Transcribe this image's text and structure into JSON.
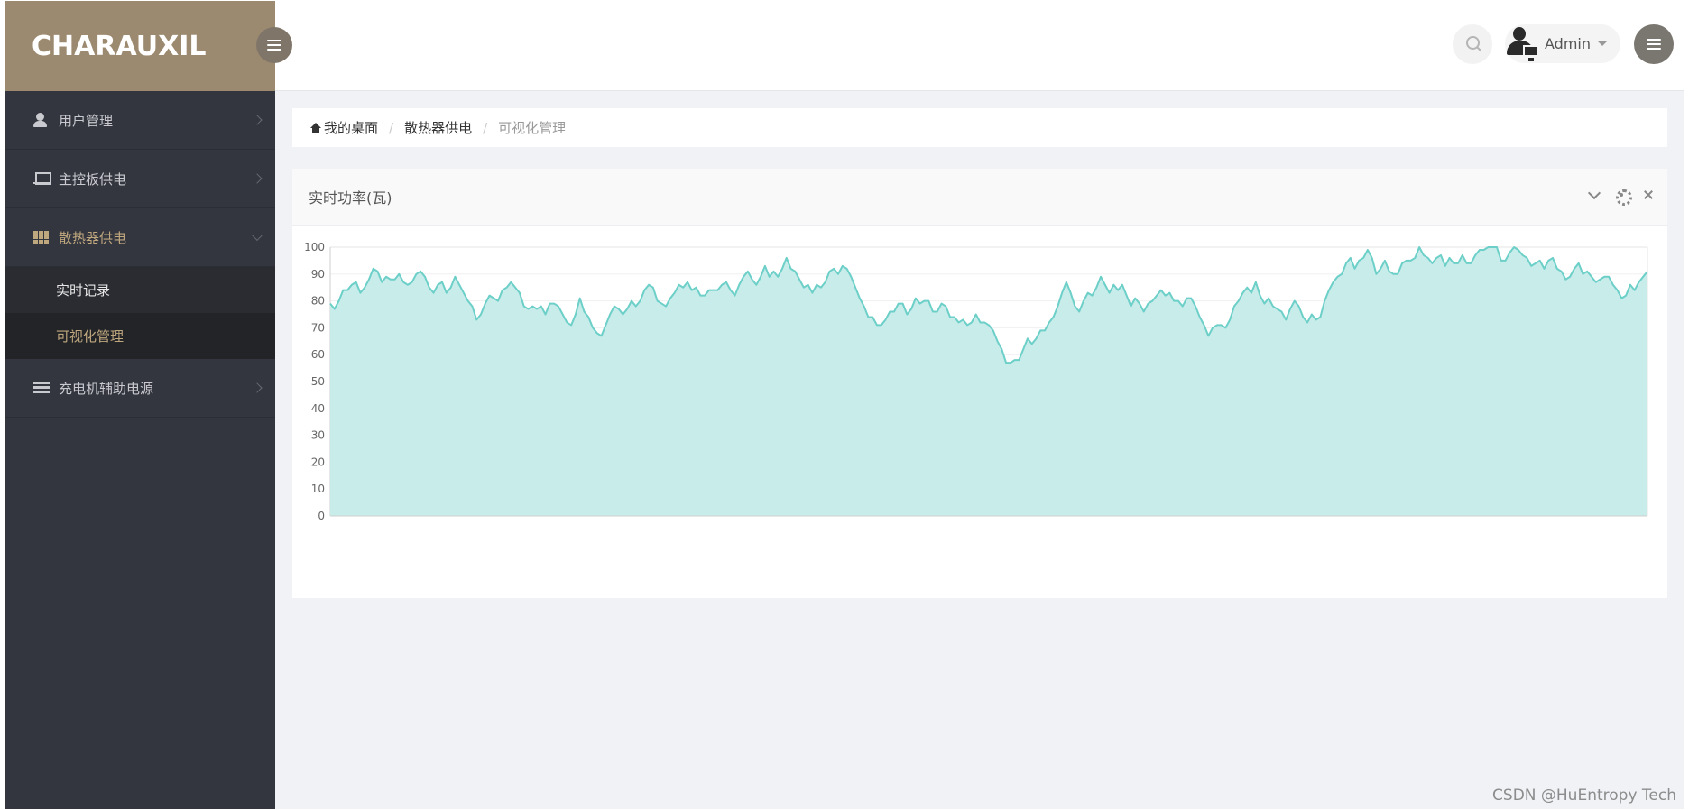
{
  "brand": {
    "name": "CHARAUXIL",
    "color": "#9c8a70"
  },
  "sidebar": {
    "items": [
      {
        "label": "用户管理",
        "icon": "user-icon"
      },
      {
        "label": "主控板供电",
        "icon": "laptop-icon"
      },
      {
        "label": "散热器供电",
        "icon": "grid-icon",
        "open": true,
        "children": [
          {
            "label": "实时记录"
          },
          {
            "label": "可视化管理",
            "active": true
          }
        ]
      },
      {
        "label": "充电机辅助电源",
        "icon": "server-icon"
      }
    ]
  },
  "header": {
    "user_name": "Admin"
  },
  "breadcrumb": {
    "home": "我的桌面",
    "section": "散热器供电",
    "current": "可视化管理"
  },
  "panel": {
    "title": "实时功率(瓦)"
  },
  "watermark": "CSDN @HuEntropy Tech",
  "chart_data": {
    "type": "area",
    "title": "",
    "ylim": [
      0,
      100
    ],
    "y_ticks": [
      0,
      10,
      20,
      30,
      40,
      50,
      60,
      70,
      80,
      90,
      100
    ],
    "grid": true,
    "line_color": "#6ccfc8",
    "fill_color": "#c8ecea",
    "series": [
      {
        "values": [
          79,
          77,
          80,
          84,
          84,
          86,
          87,
          83,
          85,
          88,
          92,
          91,
          87,
          89,
          88,
          88,
          90,
          87,
          86,
          87,
          90,
          91,
          89,
          85,
          83,
          86,
          87,
          83,
          85,
          89,
          86,
          83,
          80,
          78,
          73,
          75,
          79,
          82,
          81,
          80,
          84,
          85,
          87,
          85,
          83,
          78,
          77,
          78,
          77,
          78,
          75,
          79,
          79,
          78,
          75,
          72,
          71,
          75,
          81,
          76,
          74,
          70,
          68,
          67,
          71,
          75,
          78,
          77,
          75,
          77,
          80,
          78,
          80,
          84,
          86,
          85,
          80,
          79,
          78,
          81,
          83,
          86,
          85,
          87,
          84,
          85,
          82,
          82,
          84,
          84,
          84,
          86,
          87,
          84,
          82,
          86,
          89,
          91,
          88,
          86,
          89,
          93,
          89,
          91,
          89,
          92,
          96,
          92,
          91,
          88,
          85,
          86,
          83,
          86,
          85,
          87,
          91,
          92,
          90,
          93,
          92,
          89,
          85,
          81,
          78,
          74,
          74,
          71,
          71,
          73,
          76,
          76,
          79,
          79,
          75,
          77,
          81,
          79,
          80,
          80,
          76,
          76,
          79,
          78,
          74,
          74,
          72,
          73,
          71,
          72,
          75,
          72,
          72,
          71,
          69,
          65,
          62,
          57,
          57,
          58,
          58,
          62,
          66,
          64,
          66,
          69,
          69,
          72,
          74,
          78,
          83,
          87,
          83,
          78,
          76,
          80,
          83,
          82,
          85,
          89,
          86,
          83,
          86,
          84,
          86,
          82,
          78,
          81,
          79,
          76,
          79,
          80,
          82,
          84,
          82,
          83,
          80,
          80,
          78,
          81,
          81,
          78,
          74,
          71,
          67,
          70,
          71,
          71,
          70,
          73,
          78,
          80,
          83,
          85,
          83,
          87,
          82,
          79,
          81,
          78,
          77,
          76,
          73,
          77,
          80,
          78,
          74,
          72,
          75,
          73,
          74,
          80,
          84,
          87,
          89,
          90,
          94,
          96,
          92,
          95,
          96,
          99,
          96,
          90,
          92,
          95,
          91,
          90,
          90,
          94,
          95,
          95,
          96,
          100,
          97,
          96,
          94,
          96,
          97,
          93,
          96,
          94,
          94,
          97,
          94,
          94,
          97,
          99,
          99,
          100,
          100,
          100,
          95,
          95,
          98,
          100,
          99,
          97,
          96,
          93,
          94,
          95,
          92,
          95,
          96,
          92,
          91,
          88,
          89,
          92,
          94,
          90,
          91,
          89,
          87,
          88,
          89,
          89,
          86,
          84,
          81,
          82,
          86,
          84,
          87,
          89,
          91
        ]
      }
    ]
  }
}
